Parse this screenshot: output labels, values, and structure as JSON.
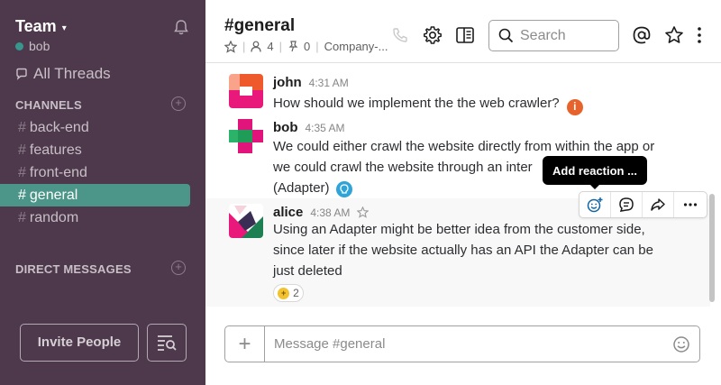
{
  "sidebar": {
    "team_name": "Team",
    "user_name": "bob",
    "all_threads": "All Threads",
    "channels_title": "CHANNELS",
    "channels": [
      {
        "name": "back-end"
      },
      {
        "name": "features"
      },
      {
        "name": "front-end"
      },
      {
        "name": "general",
        "active": true
      },
      {
        "name": "random"
      }
    ],
    "dm_title": "DIRECT MESSAGES",
    "invite_label": "Invite People",
    "hash": "#"
  },
  "header": {
    "title": "#general",
    "members_count": "4",
    "pinned_count": "0",
    "topic": "Company-..."
  },
  "search": {
    "placeholder": "Search"
  },
  "messages": [
    {
      "author": "john",
      "time": "4:31 AM",
      "text": "How should we implement the the web crawler?"
    },
    {
      "author": "bob",
      "time": "4:35 AM",
      "text_line1": "We could either crawl the website directly from within the app or",
      "text_line2": "we could crawl the website through an inter",
      "text_line3": "(Adapter)"
    },
    {
      "author": "alice",
      "time": "4:38 AM",
      "text_line1": "Using an Adapter might be better idea from the customer side,",
      "text_line2": "since later if the website actually has an API the Adapter can be",
      "text_line3": "just deleted",
      "reaction_count": "2"
    }
  ],
  "tooltip": "Add reaction ...",
  "composer": {
    "placeholder": "Message #general"
  },
  "colors": {
    "sidebar_bg": "#4d394b",
    "active_channel": "#4c9689",
    "online": "#38978d",
    "info_badge": "#e8622c"
  },
  "icons": [
    "chevron-down-icon",
    "bell-icon",
    "threads-icon",
    "star-icon",
    "user-icon",
    "pin-icon",
    "phone-icon",
    "gear-icon",
    "sidebar-toggle-icon",
    "search-icon",
    "at-icon",
    "more-vertical-icon",
    "add-emoji-icon",
    "comment-icon",
    "share-icon",
    "more-horizontal-icon",
    "plus-icon",
    "emoji-icon",
    "list-search-icon",
    "info-icon",
    "lightbulb-icon"
  ]
}
